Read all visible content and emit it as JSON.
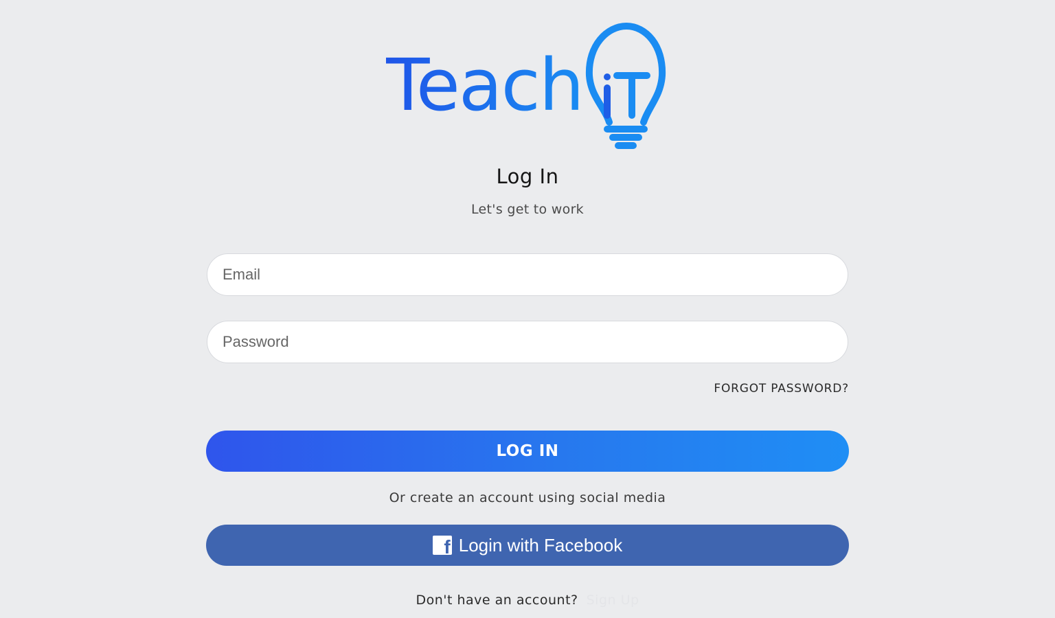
{
  "brand": {
    "name": "Teach",
    "icon_letters": "iT",
    "primary_color": "#1f5ee6",
    "accent_color": "#1a8cf2"
  },
  "header": {
    "title": "Log In",
    "subtitle": "Let's get to work"
  },
  "form": {
    "email_placeholder": "Email",
    "email_value": "",
    "password_placeholder": "Password",
    "password_value": "",
    "forgot_label": "FORGOT PASSWORD?",
    "login_label": "LOG IN"
  },
  "social": {
    "prompt": "Or create an account using social media",
    "facebook_label": "Login with Facebook",
    "facebook_icon": "facebook-icon",
    "facebook_color": "#3f65b0"
  },
  "footer": {
    "no_account_text": "Don't have an account?",
    "signup_label": "Sign Up"
  }
}
